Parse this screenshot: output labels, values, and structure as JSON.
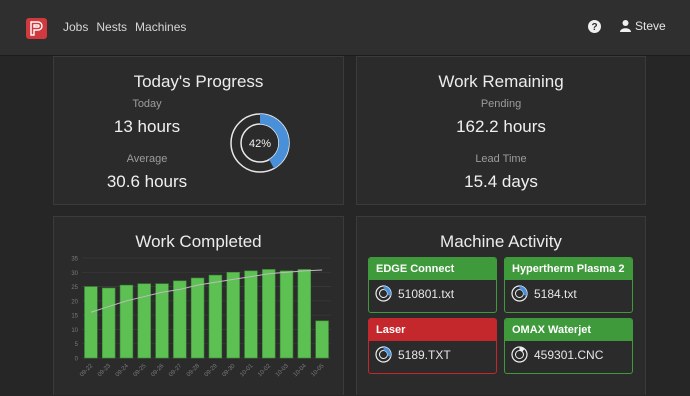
{
  "nav": {
    "items": [
      "Jobs",
      "Nests",
      "Machines"
    ],
    "user_name": "Steve"
  },
  "colors": {
    "brand": "#d0393d",
    "accent_blue": "#4a90d9",
    "green": "#3f9a3c",
    "red": "#c5282c",
    "bar": "#5cc052"
  },
  "progress": {
    "title": "Today's Progress",
    "today_label": "Today",
    "today_value": "13 hours",
    "average_label": "Average",
    "average_value": "30.6 hours",
    "donut_percent": 42,
    "donut_label": "42%"
  },
  "remaining": {
    "title": "Work Remaining",
    "pending_label": "Pending",
    "pending_value": "162.2 hours",
    "lead_label": "Lead Time",
    "lead_value": "15.4 days"
  },
  "completed": {
    "title": "Work Completed"
  },
  "chart_data": {
    "type": "bar",
    "categories": [
      "09-22",
      "09-23",
      "09-24",
      "09-25",
      "09-26",
      "09-27",
      "09-28",
      "09-29",
      "09-30",
      "10-01",
      "10-02",
      "10-03",
      "10-04",
      "10-05"
    ],
    "values": [
      25,
      24.5,
      25.5,
      26,
      26,
      27,
      28,
      29,
      30,
      30.5,
      31,
      30.5,
      31,
      13
    ],
    "trend": [
      16,
      18,
      20,
      21.5,
      23,
      24,
      25.5,
      26.5,
      27.5,
      28.5,
      29.5,
      30,
      30.5,
      30.8
    ],
    "yticks": [
      0,
      5,
      10,
      15,
      20,
      25,
      30,
      35
    ],
    "ylim": [
      0,
      35
    ],
    "grid": true
  },
  "activity": {
    "title": "Machine Activity",
    "machines": [
      {
        "name": "EDGE Connect",
        "file": "510801.txt",
        "status": "green",
        "icon": "progress-ring-icon"
      },
      {
        "name": "Hypertherm Plasma 2",
        "file": "5184.txt",
        "status": "green",
        "icon": "progress-ring-icon"
      },
      {
        "name": "Laser",
        "file": "5189.TXT",
        "status": "red",
        "icon": "progress-ring-icon"
      },
      {
        "name": "OMAX Waterjet",
        "file": "459301.CNC",
        "status": "green",
        "icon": "progress-ring-icon"
      }
    ]
  }
}
